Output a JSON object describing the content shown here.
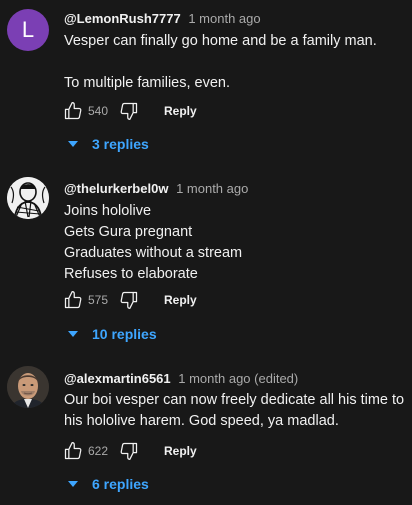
{
  "comments": [
    {
      "avatar_letter": "L",
      "author": "@LemonRush7777",
      "time": "1 month ago",
      "lines": [
        "Vesper can finally go home and be a family man.",
        "",
        "To multiple families, even."
      ],
      "likes": "540",
      "reply_label": "Reply",
      "replies_label": "3 replies"
    },
    {
      "author": "@thelurkerbel0w",
      "time": "1 month ago",
      "lines": [
        "Joins hololive",
        "Gets Gura pregnant",
        "Graduates without a stream",
        "Refuses to elaborate"
      ],
      "likes": "575",
      "reply_label": "Reply",
      "replies_label": "10 replies"
    },
    {
      "author": "@alexmartin6561",
      "time": "1 month ago (edited)",
      "lines": [
        "Our boi vesper can now freely dedicate all his time to",
        "his hololive harem. God speed, ya madlad."
      ],
      "likes": "622",
      "reply_label": "Reply",
      "replies_label": "6 replies"
    }
  ],
  "colors": {
    "background": "#181818",
    "link_blue": "#3ea6ff",
    "avatar_purple": "#7b3fb4",
    "muted_text": "#aaaaaa"
  },
  "icons": {
    "like": "thumbs-up-icon",
    "dislike": "thumbs-down-icon",
    "replies_toggle": "caret-down-icon"
  }
}
